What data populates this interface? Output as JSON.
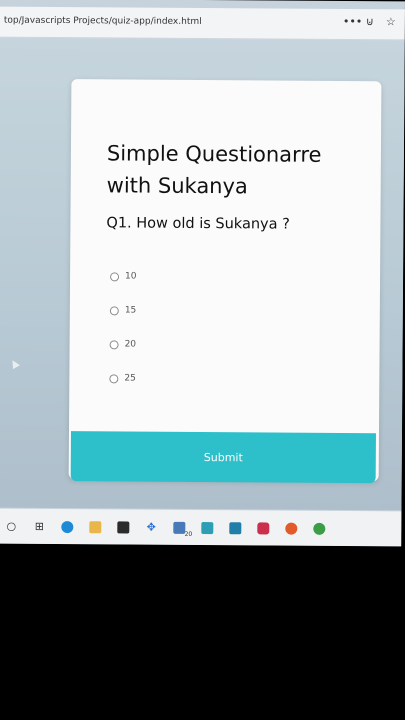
{
  "browser": {
    "url": "top/Javascripts Projects/quiz-app/index.html",
    "icons": [
      "more-icon",
      "pocket-icon",
      "star-icon"
    ]
  },
  "quiz": {
    "title": "Simple Questionarre with Sukanya",
    "question": "Q1. How old is Sukanya ?",
    "options": [
      "10",
      "15",
      "20",
      "25"
    ],
    "submit_label": "Submit"
  },
  "taskbar": {
    "items": [
      {
        "name": "start-icon",
        "glyph": "○"
      },
      {
        "name": "task-view-icon",
        "glyph": "⊞"
      },
      {
        "name": "edge-icon",
        "color": "#1e8ad6"
      },
      {
        "name": "file-explorer-icon",
        "color": "#e8b64a"
      },
      {
        "name": "store-icon",
        "color": "#2b2b2b"
      },
      {
        "name": "dropbox-icon",
        "glyph": "✥"
      },
      {
        "name": "mail-icon",
        "color": "#4a79b8",
        "badge": "20"
      },
      {
        "name": "l-app-icon",
        "color": "#2d9fb5"
      },
      {
        "name": "photoshop-icon",
        "color": "#1f7fa8"
      },
      {
        "name": "pocket-app-icon",
        "color": "#cc2f4c"
      },
      {
        "name": "firefox-icon",
        "color": "#e25a2a"
      },
      {
        "name": "chrome-icon",
        "color": "#3b9e46"
      }
    ]
  },
  "colors": {
    "accent": "#2dbfca",
    "card": "#fbfbfb",
    "background": "#c6d5dd"
  }
}
